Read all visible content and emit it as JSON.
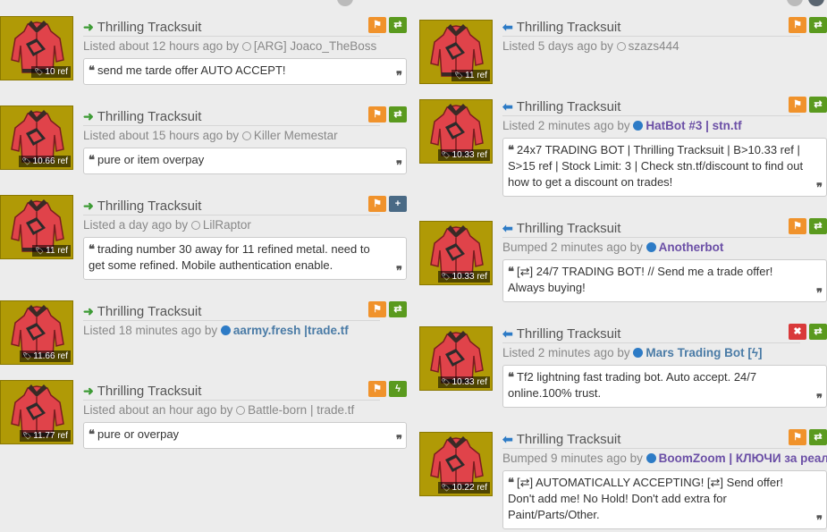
{
  "item_name": "Thrilling Tracksuit",
  "left": [
    {
      "direction": "buy",
      "price": "10 ref",
      "meta": "Listed about 12 hours ago by",
      "user": "[ARG] Joaco_TheBoss",
      "user_style": "plain",
      "online": false,
      "comment": "send me tarde offer AUTO ACCEPT!",
      "buttons": [
        "flag",
        "trade"
      ]
    },
    {
      "direction": "buy",
      "price": "10.66 ref",
      "meta": "Listed about 15 hours ago by",
      "user": "Killer Memestar",
      "user_style": "plain",
      "online": false,
      "comment": "pure or item overpay",
      "buttons": [
        "flag",
        "trade"
      ]
    },
    {
      "direction": "buy",
      "price": "11 ref",
      "meta": "Listed a day ago by",
      "user": "LilRaptor",
      "user_style": "plain",
      "online": false,
      "comment": "trading number 30 away for 11 refined metal. need to get some refined. Mobile authentication enable.",
      "buttons": [
        "flag",
        "plus"
      ]
    },
    {
      "direction": "buy",
      "price": "11.66 ref",
      "meta": "Listed 18 minutes ago by",
      "user": "aarmy.fresh |trade.tf",
      "user_style": "bot",
      "online": true,
      "comment": "",
      "buttons": [
        "flag",
        "trade"
      ]
    },
    {
      "direction": "buy",
      "price": "11.77 ref",
      "meta": "Listed about an hour ago by",
      "user": "Battle-born | trade.tf",
      "user_style": "plain",
      "online": false,
      "comment": "pure or overpay",
      "buttons": [
        "flag",
        "bolt"
      ]
    }
  ],
  "right": [
    {
      "direction": "sell",
      "price": "11 ref",
      "meta": "Listed 5 days ago by",
      "user": "szazs444",
      "user_style": "plain",
      "online": false,
      "comment": "",
      "buttons": [
        "flag",
        "trade"
      ]
    },
    {
      "direction": "sell",
      "price": "10.33 ref",
      "meta": "Listed 2 minutes ago by",
      "user": "HatBot #3 | stn.tf",
      "user_style": "purple",
      "online": true,
      "comment": "24x7 TRADING BOT | Thrilling Tracksuit | B>10.33 ref | S>15 ref | Stock Limit: 3 | Check stn.tf/discount to find out how to get a discount on trades!",
      "buttons": [
        "flag",
        "trade"
      ]
    },
    {
      "direction": "sell",
      "price": "10.33 ref",
      "meta": "Bumped 2 minutes ago by",
      "user": "Anotherbot",
      "user_style": "purple",
      "online": true,
      "comment": "[⇄] 24/7 TRADING BOT! // Send me a trade offer! Always buying!",
      "buttons": [
        "flag",
        "trade"
      ]
    },
    {
      "direction": "sell",
      "price": "10.33 ref",
      "meta": "Listed 2 minutes ago by",
      "user": "Mars Trading Bot [ϟ]",
      "user_style": "bot",
      "online": true,
      "comment": "Tf2 lightning fast trading bot. Auto accept. 24/7 online.100% trust.",
      "buttons": [
        "close",
        "trade"
      ]
    },
    {
      "direction": "sell",
      "price": "10.22 ref",
      "meta": "Bumped 9 minutes ago by",
      "user": "BoomZoom | КЛЮЧИ за реал",
      "user_style": "purple",
      "online": true,
      "comment": "[⇄] AUTOMATICALLY ACCEPTING! [⇄] Send offer! Don't add me! No Hold! Don't add extra for Paint/Parts/Other.",
      "buttons": [
        "flag",
        "trade"
      ]
    }
  ]
}
